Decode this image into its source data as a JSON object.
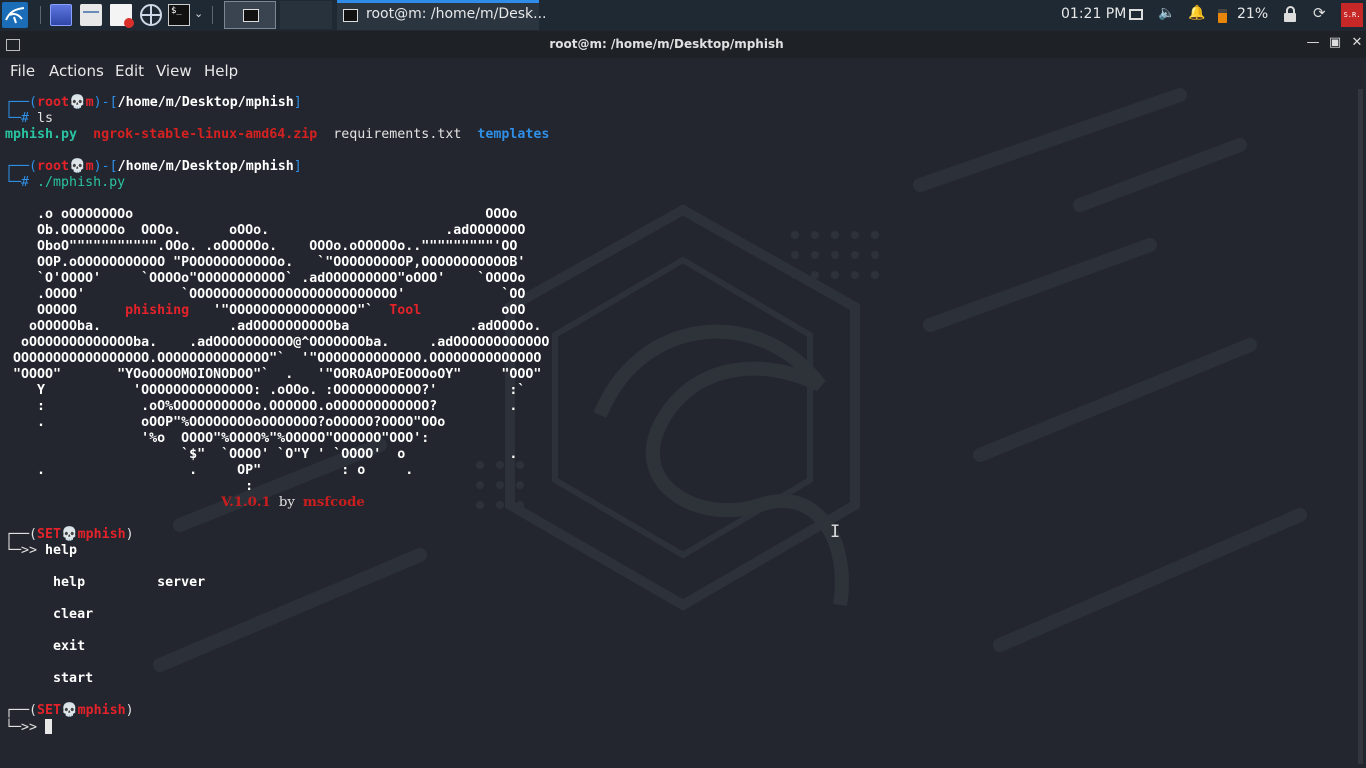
{
  "taskbar": {
    "window_title": "root@m: /home/m/Desk...",
    "clock": "01:21 PM",
    "battery": "21%",
    "user_badge": "S.R.",
    "icons": [
      "kali-menu-icon",
      "show-desktop-icon",
      "file-manager-icon",
      "text-editor-icon",
      "browser-icon",
      "terminal-icon",
      "chevron-down-icon",
      "display-icon",
      "volume-icon",
      "bell-icon",
      "battery-icon",
      "lock-icon",
      "logout-icon"
    ]
  },
  "window": {
    "title": "root@m: /home/m/Desktop/mphish",
    "controls": [
      "minimize",
      "maximize",
      "close"
    ]
  },
  "menu": [
    "File",
    "Actions",
    "Edit",
    "View",
    "Help"
  ],
  "prompt1": {
    "open": "┌──(",
    "user": "root",
    "skull": "💀",
    "host": "m",
    "mid": ")-[",
    "path": "/home/m/Desktop/mphish",
    "close": "]",
    "hash": "└─#",
    "cmd": " ls"
  },
  "ls_output": {
    "f1": "mphish.py",
    "f2": "ngrok-stable-linux-amd64.zip",
    "f3": "requirements.txt",
    "f4": "templates"
  },
  "prompt2": {
    "open": "┌──(",
    "user": "root",
    "skull": "💀",
    "host": "m",
    "mid": ")-[",
    "path": "/home/m/Desktop/mphish",
    "close": "]",
    "hash": "└─#",
    "cmd": " ./mphish.py"
  },
  "banner": {
    "l1": "    .o oOOOOOOOo                                            OOOo",
    "l2": "    Ob.OOOOOOOo  OOOo.      oOOo.                      .adOOOOOOO",
    "l3": "    OboO\"\"\"\"\"\"\"\"\"\"\".OOo. .oOOOOOo.    OOOo.oOOOOOo..\"\"\"\"\"\"\"\"\"'OO",
    "l4": "    OOP.oOOOOOOOOOOO \"POOOOOOOOOOOo.   `\"OOOOOOOOOP,OOOOOOOOOOOB'",
    "l5": "    `O'OOOO'     `OOOOo\"OOOOOOOOOOO` .adOOOOOOOOO\"oOOO'    `OOOOo",
    "l6": "    .OOOO'            `OOOOOOOOOOOOOOOOOOOOOOOOOO'            `OO",
    "l7a": "    OOOOO      ",
    "l7_phishing": "phishing",
    "l7b": "   '\"OOOOOOOOOOOOOOOO\"`  ",
    "l7_tool": "Tool",
    "l7c": "          oOO",
    "l8": "   oOOOOOba.                .adOOOOOOOOOOba               .adOOOOo.",
    "l9": "  oOOOOOOOOOOOOOba.    .adOOOOOOOOOO@^OOOOOOOba.     .adOOOOOOOOOOOO",
    "l10": " OOOOOOOOOOOOOOOOO.OOOOOOOOOOOOOO\"`  '\"OOOOOOOOOOOOO.OOOOOOOOOOOOOO",
    "l11": " \"OOOO\"       \"YOoOOOOMOIONODOO\"`  .   '\"OOROAOPOEOOOoOY\"     \"OOO\"",
    "l12": "    Y           'OOOOOOOOOOOOOO: .oOOo. :OOOOOOOOOOO?'         :`",
    "l13": "    :            .oO%OOOOOOOOOOo.OOOOOO.oOOOOOOOOOOOO?         .",
    "l14": "    .            oOOP\"%OOOOOOOOoOOOOOOO?oOOOOO?OOOO\"OOo",
    "l15": "                 '%o  OOOO\"%OOOO%\"%OOOOO\"OOOOOO\"OOO':",
    "l16": "                      `$\"  `OOOO' `O\"Y ' `OOOO'  o             .",
    "l17": "    .                  .     OP\"          : o     .",
    "l18": "                              :",
    "ver_pad": "                           ",
    "version": "V.1.0.1",
    "by": "by",
    "author": "msfcode"
  },
  "set_prompt": {
    "open": "┌──(",
    "name": "SET",
    "skull": "💀",
    "tool": "mphish",
    "close": ")",
    "arrow": "└─>>"
  },
  "help_session": {
    "cmd": " help",
    "help": "help",
    "server": "server",
    "clear": "clear",
    "exit": "exit",
    "start": "start"
  }
}
